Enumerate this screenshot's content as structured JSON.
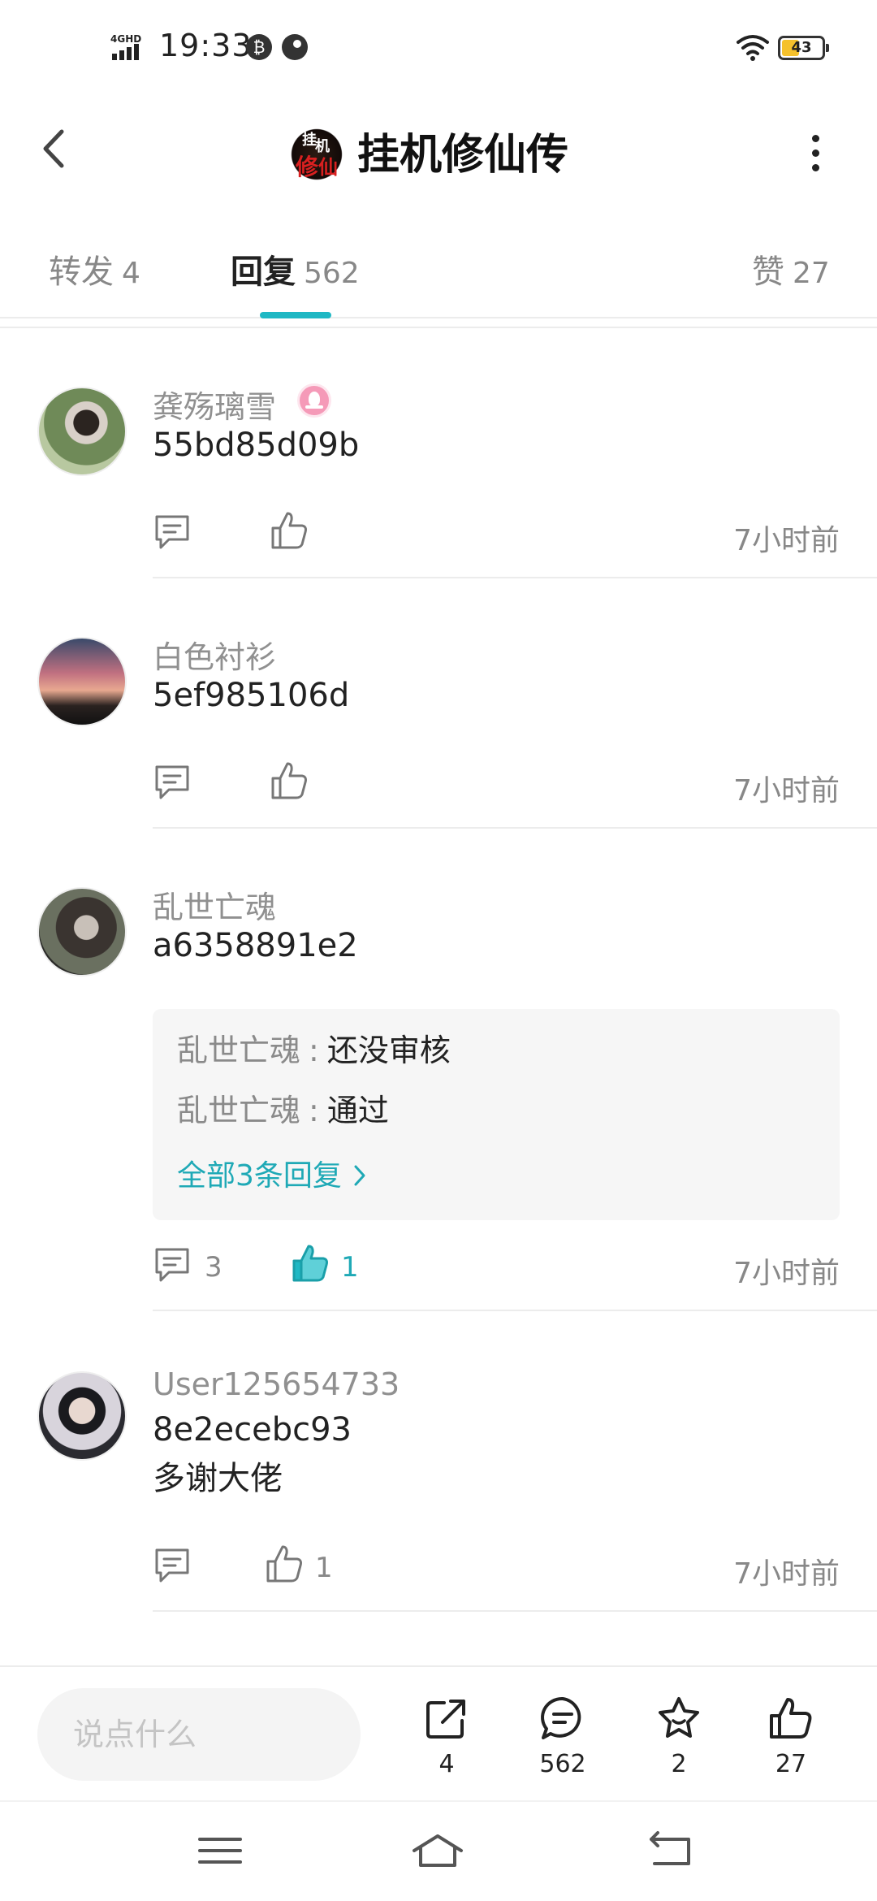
{
  "status_bar": {
    "network": "4GHD",
    "time": "19:33",
    "battery_level": "43",
    "battery_fraction": 0.43
  },
  "header": {
    "title": "挂机修仙传",
    "logo_text": [
      "挂",
      "机",
      "修",
      "仙"
    ]
  },
  "tabs": [
    {
      "label": "转发",
      "count": "4",
      "active": false
    },
    {
      "label": "回复",
      "count": "562",
      "active": true
    },
    {
      "label": "赞",
      "count": "27",
      "active": false
    }
  ],
  "comments": [
    {
      "username": "龚殇璃雪",
      "has_badge": true,
      "text": "55bd85d09b",
      "reply_count": "",
      "like_count": "",
      "liked": false,
      "time": "7小时前"
    },
    {
      "username": "白色衬衫",
      "has_badge": false,
      "text": "5ef985106d",
      "reply_count": "",
      "like_count": "",
      "liked": false,
      "time": "7小时前"
    },
    {
      "username": "乱世亡魂",
      "has_badge": false,
      "text": "a6358891e2",
      "replies": [
        {
          "user": "乱世亡魂",
          "separator": ":",
          "text": "还没审核"
        },
        {
          "user": "乱世亡魂",
          "separator": ":",
          "text": "通过"
        }
      ],
      "replies_more": "全部3条回复",
      "reply_count": "3",
      "like_count": "1",
      "liked": true,
      "time": "7小时前"
    },
    {
      "username": "User125654733",
      "has_badge": false,
      "text": "8e2ecebc93",
      "text_line2": "多谢大佬",
      "reply_count": "",
      "like_count": "1",
      "liked": false,
      "time": "7小时前"
    }
  ],
  "bottom_bar": {
    "input_placeholder": "说点什么",
    "share_count": "4",
    "comment_count": "562",
    "favorite_count": "2",
    "like_count": "27"
  },
  "colors": {
    "accent": "#1fb8c4",
    "accent_text": "#1fa9b6",
    "badge_pink": "#f59ab8"
  },
  "icons": [
    "back-icon",
    "more-icon",
    "badge-icon",
    "reply-icon",
    "like-icon",
    "share-icon",
    "comment-icon",
    "star-icon",
    "menu-icon",
    "home-icon",
    "return-icon"
  ]
}
